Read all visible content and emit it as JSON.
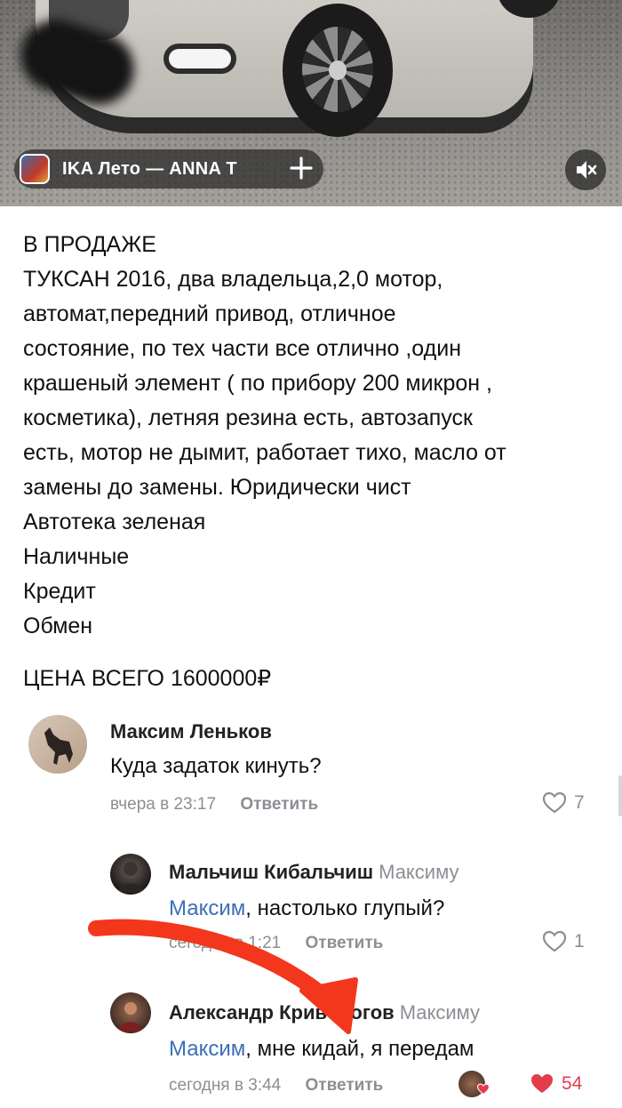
{
  "music": {
    "label": "IKA   Лето — ANNA T",
    "thumb_icon": "album-cover-thumbnail",
    "add_icon": "plus-icon"
  },
  "mute_icon": "speaker-muted-icon",
  "post": {
    "lines": [
      "В ПРОДАЖЕ",
      "ТУКСАН 2016, два владельца,2,0 мотор,",
      "автомат,передний привод, отличное",
      "состояние, по тех части все отлично ,один",
      "крашеный элемент ( по прибору 200 микрон ,",
      "косметика), летняя резина есть, автозапуск",
      "есть, мотор не дымит, работает тихо, масло от",
      "замены до замены. Юридически чист",
      "Автотека зеленая",
      "Наличные",
      "Кредит",
      "Обмен"
    ],
    "price": "ЦЕНА ВСЕГО 1600000₽"
  },
  "comments": [
    {
      "author": "Максим Леньков",
      "reply_to": "",
      "mention": "",
      "text": "Куда задаток кинуть?",
      "time": "вчера в 23:17",
      "reply_label": "Ответить",
      "likes": "7",
      "liked": false
    },
    {
      "author": "Мальчиш Кибальчиш",
      "reply_to": "Максиму",
      "mention": "Максим",
      "text": ", настолько глупый?",
      "time": "сегодня в 1:21",
      "reply_label": "Ответить",
      "likes": "1",
      "liked": false
    },
    {
      "author": "Александр Кривоногов",
      "reply_to": "Максиму",
      "mention": "Максим",
      "text": ", мне кидай, я передам",
      "time": "сегодня в 3:44",
      "reply_label": "Ответить",
      "likes": "54",
      "liked": true
    }
  ],
  "colors": {
    "mention": "#3b6fb6",
    "muted_text": "#8b8f94",
    "like_active": "#e33c4b",
    "annotation_arrow": "#f2371c"
  }
}
